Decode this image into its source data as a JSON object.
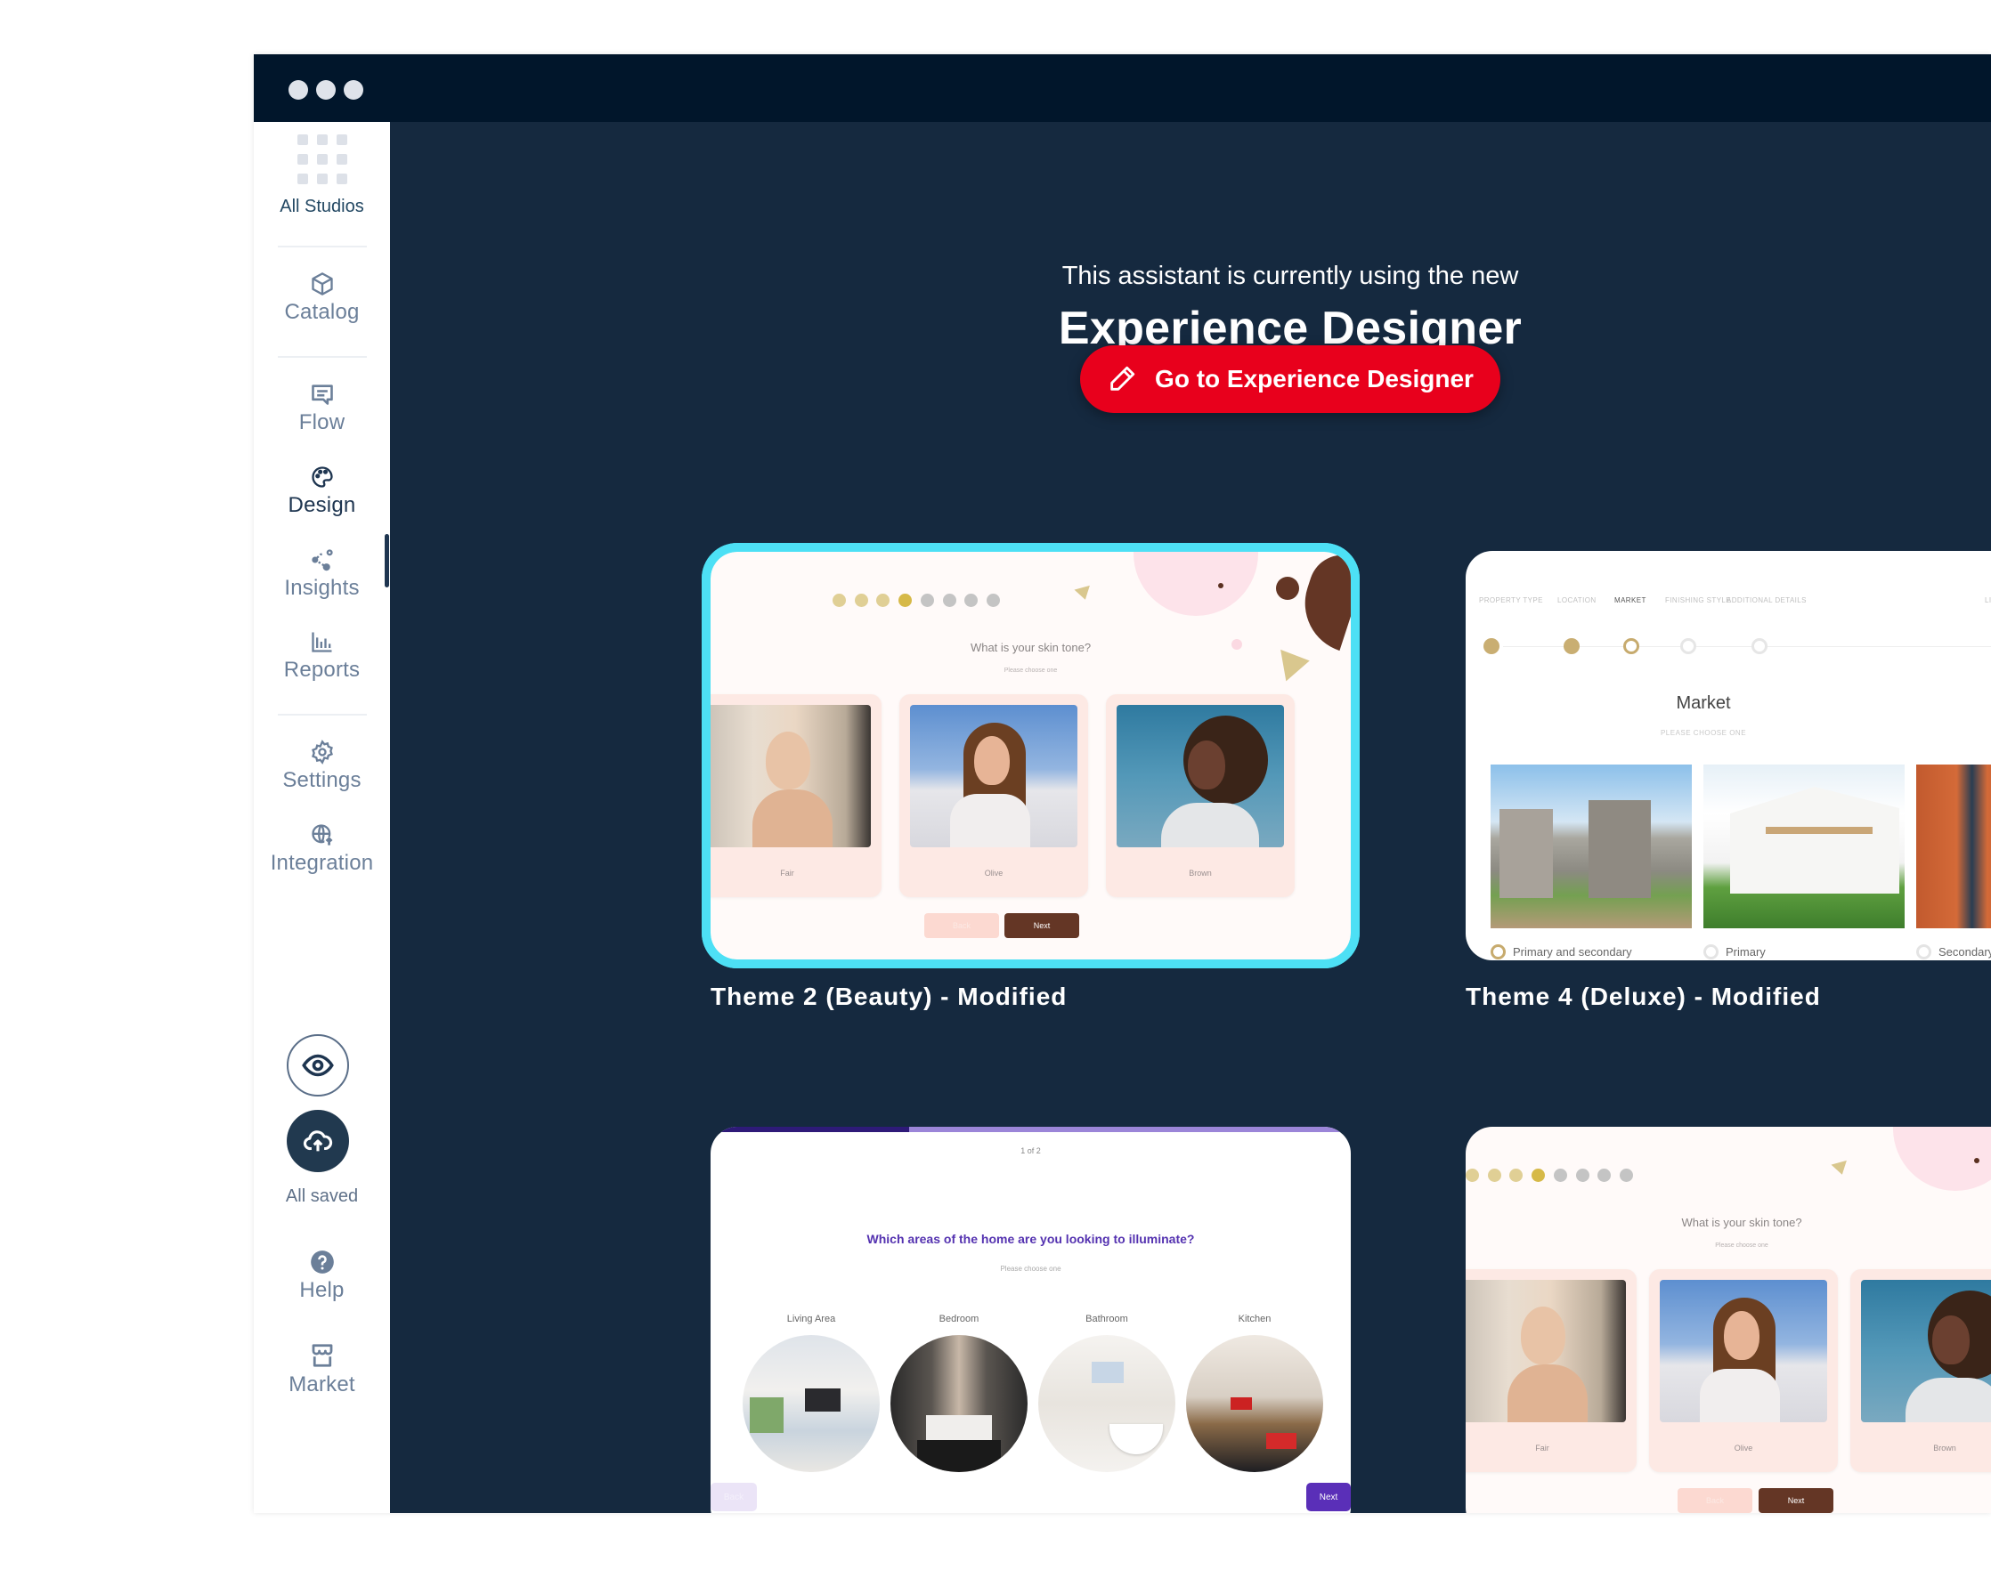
{
  "window": {
    "controls": [
      "dot",
      "dot",
      "dot"
    ]
  },
  "sidebar": {
    "studios": {
      "label": "All Studios",
      "icon": "grid-icon"
    },
    "items": [
      {
        "id": "catalog",
        "label": "Catalog",
        "icon": "cube-icon",
        "active": false
      },
      {
        "id": "flow",
        "label": "Flow",
        "icon": "chat-icon",
        "active": false
      },
      {
        "id": "design",
        "label": "Design",
        "icon": "palette-icon",
        "active": true
      },
      {
        "id": "insights",
        "label": "Insights",
        "icon": "share-nodes-icon",
        "active": false
      },
      {
        "id": "reports",
        "label": "Reports",
        "icon": "bar-chart-icon",
        "active": false
      },
      {
        "id": "settings",
        "label": "Settings",
        "icon": "gear-icon",
        "active": false
      },
      {
        "id": "integration",
        "label": "Integration",
        "icon": "globe-upload-icon",
        "active": false
      }
    ],
    "preview_icon": "eye-icon",
    "save_icon": "cloud-upload-icon",
    "save_status": "All saved",
    "help": {
      "label": "Help",
      "icon": "question-circle-icon"
    },
    "market": {
      "label": "Market",
      "icon": "storefront-icon"
    }
  },
  "intro": {
    "subtitle": "This assistant is currently using the new",
    "title": "Experience Designer",
    "cta_label": "Go to Experience Designer",
    "cta_icon": "pencil-icon",
    "cta_color": "#e8001c"
  },
  "colors": {
    "background": "#15293f",
    "titlebar": "#01162b",
    "selected_outline": "#4de0f5"
  },
  "themes": [
    {
      "label": "Theme 2 (Beauty) - Modified",
      "selected": true,
      "preview": {
        "progress_dots": {
          "total": 8,
          "completed": 3,
          "current": 4
        },
        "question": "What is your skin tone?",
        "hint": "Please choose one",
        "options": [
          "Fair",
          "Olive",
          "Brown"
        ],
        "back_label": "Back",
        "next_label": "Next"
      }
    },
    {
      "label": "Theme 4 (Deluxe) - Modified",
      "selected": false,
      "preview": {
        "steps": [
          "PROPERTY TYPE",
          "LOCATION",
          "MARKET",
          "FINISHING STYLE",
          "ADDITIONAL DETAILS",
          "LIF"
        ],
        "completed_steps": 2,
        "current_step": "MARKET",
        "question": "Market",
        "hint": "PLEASE CHOOSE ONE",
        "options": [
          {
            "label": "Primary and secondary",
            "selected": true
          },
          {
            "label": "Primary",
            "selected": false
          },
          {
            "label": "Secondary",
            "selected": false
          }
        ]
      }
    },
    {
      "label": "",
      "selected": false,
      "preview": {
        "progress_text": "1 of 2",
        "progress": 0.31,
        "question": "Which areas of the home are you looking to illuminate?",
        "hint": "Please choose one",
        "options": [
          "Living Area",
          "Bedroom",
          "Bathroom",
          "Kitchen"
        ],
        "back_label": "Back",
        "next_label": "Next"
      }
    },
    {
      "label": "",
      "selected": false,
      "preview": {
        "progress_dots": {
          "total": 8,
          "completed": 3,
          "current": 4
        },
        "question": "What is your skin tone?",
        "hint": "Please choose one",
        "options": [
          "Fair",
          "Olive",
          "Brown"
        ],
        "back_label": "Back",
        "next_label": "Next"
      }
    }
  ]
}
